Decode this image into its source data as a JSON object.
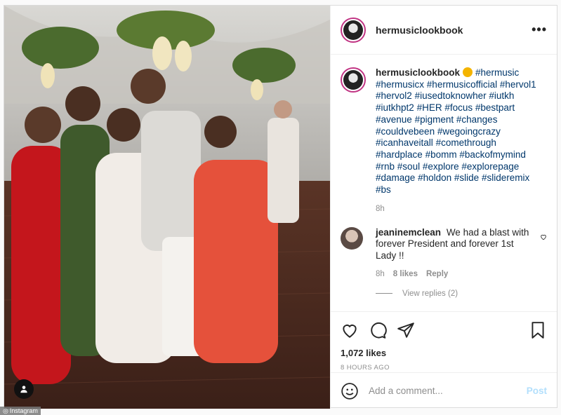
{
  "post": {
    "username": "hermusiclookbook",
    "more_label": "•••",
    "caption": {
      "username": "hermusiclookbook",
      "hashtags": [
        "#hermusic",
        "#hermusicx",
        "#hermusicofficial",
        "#hervol1",
        "#hervol2",
        "#iusedtoknowher",
        "#iutkh",
        "#iutkhpt2",
        "#HER",
        "#focus",
        "#bestpart",
        "#avenue",
        "#pigment",
        "#changes",
        "#couldvebeen",
        "#wegoingcrazy",
        "#icanhaveitall",
        "#comethrough",
        "#hardplace",
        "#bomm",
        "#backofmymind",
        "#rnb",
        "#soul",
        "#explore",
        "#explorepage",
        "#damage",
        "#holdon",
        "#slide",
        "#slideremix",
        "#bs"
      ],
      "time": "8h"
    },
    "comments": [
      {
        "username": "jeaninemclean",
        "text": "We had a blast with forever President and forever 1st Lady !!",
        "time": "8h",
        "likes": "8 likes",
        "reply_label": "Reply"
      }
    ],
    "view_replies": "View replies (2)",
    "likes_count": "1,072 likes",
    "timestamp": "8 HOURS AGO",
    "add_comment_placeholder": "Add a comment...",
    "post_button": "Post"
  },
  "watermark": "Instagram",
  "icons": {
    "like": "heart-icon",
    "comment": "comment-icon",
    "share": "paper-plane-icon",
    "save": "bookmark-icon",
    "emoji": "emoji-icon",
    "tag": "user-tag-icon"
  },
  "colors": {
    "link": "#00376b",
    "muted": "#8e8e8e",
    "post_button": "#b2dffc",
    "story_ring": "#c13584"
  }
}
